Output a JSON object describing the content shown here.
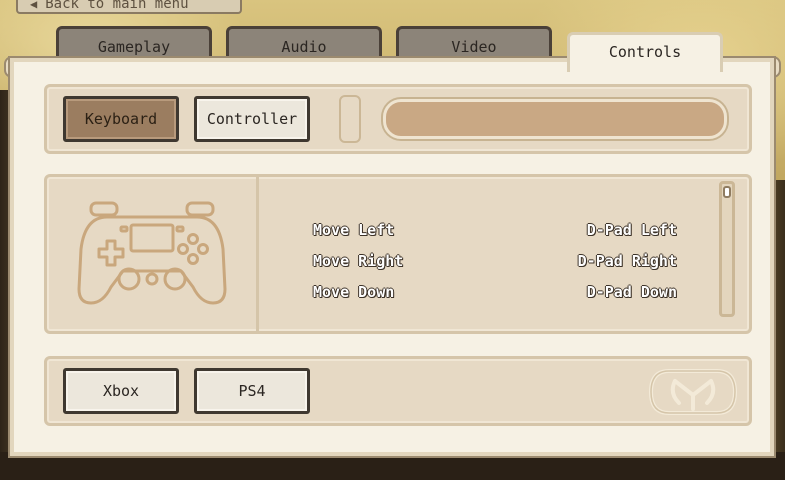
{
  "back_button": {
    "label": "Back to main menu"
  },
  "tabs": [
    {
      "label": "Gameplay",
      "active": false
    },
    {
      "label": "Audio",
      "active": false
    },
    {
      "label": "Video",
      "active": false
    },
    {
      "label": "Controls",
      "active": true
    }
  ],
  "input_mode": {
    "options": [
      {
        "label": "Keyboard",
        "selected": true
      },
      {
        "label": "Controller",
        "selected": false
      }
    ]
  },
  "search": {
    "value": ""
  },
  "bindings": [
    {
      "action": "Move Left",
      "binding": "D-Pad Left"
    },
    {
      "action": "Move Right",
      "binding": "D-Pad Right"
    },
    {
      "action": "Move Down",
      "binding": "D-Pad Down"
    }
  ],
  "scroll": {
    "position": 0
  },
  "layouts": [
    {
      "label": "Xbox"
    },
    {
      "label": "PS4"
    }
  ],
  "colors": {
    "panel": "#f6f1e4",
    "section": "#e6d9c4",
    "selected_button": "#9b7d60",
    "tab_inactive": "#8c8479",
    "outline": "#c9a77d"
  },
  "icons": {
    "controller": "gamepad-icon",
    "emblem": "crest-emblem-icon"
  }
}
